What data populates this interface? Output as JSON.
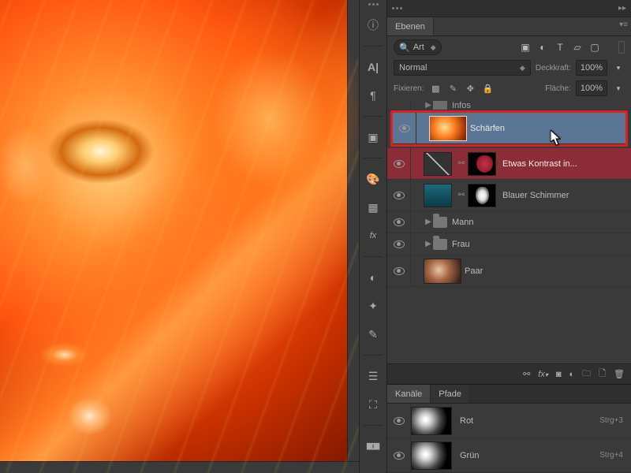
{
  "panels": {
    "layers_title": "Ebenen",
    "channels_title": "Kanäle",
    "paths_title": "Pfade"
  },
  "search": {
    "kind_label": "Art"
  },
  "blend": {
    "mode": "Normal",
    "opacity_label": "Deckkraft:",
    "opacity_value": "100%",
    "lock_label": "Fixieren:",
    "fill_label": "Fläche:",
    "fill_value": "100%"
  },
  "layers": [
    {
      "id": "infos",
      "type": "group",
      "name": "Infos",
      "visible": false,
      "expanded": false
    },
    {
      "id": "scharfen",
      "type": "image",
      "name": "Schärfen",
      "visible": true,
      "selected": true
    },
    {
      "id": "kontrast",
      "type": "adjustment",
      "name": "Etwas Kontrast in...",
      "visible": true,
      "mask": true
    },
    {
      "id": "schimmer",
      "type": "image",
      "name": "Blauer Schimmer",
      "visible": true,
      "mask": true
    },
    {
      "id": "mann",
      "type": "group",
      "name": "Mann",
      "visible": true,
      "expanded": false
    },
    {
      "id": "frau",
      "type": "group",
      "name": "Frau",
      "visible": true,
      "expanded": false
    },
    {
      "id": "paar",
      "type": "image",
      "name": "Paar",
      "visible": true
    }
  ],
  "channels": [
    {
      "name": "Rot",
      "shortcut": "Strg+3"
    },
    {
      "name": "Grün",
      "shortcut": "Strg+4"
    }
  ],
  "colors": {
    "highlight_border": "#dc2020",
    "selection_bg": "#5b7694",
    "adjustment_bg": "#8c2c38"
  }
}
